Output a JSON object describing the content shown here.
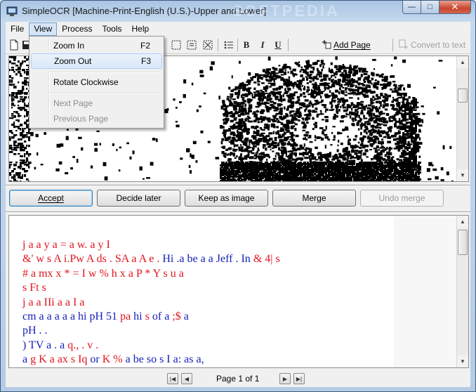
{
  "window": {
    "title": "SimpleOCR [Machine-Print-English (U.S.)-Upper and Lower]",
    "watermark": "SOFTPEDIA",
    "caption": {
      "minimize": "—",
      "maximize": "□",
      "close": "✕"
    }
  },
  "menubar": {
    "items": [
      {
        "label": "File"
      },
      {
        "label": "View"
      },
      {
        "label": "Process"
      },
      {
        "label": "Tools"
      },
      {
        "label": "Help"
      }
    ]
  },
  "view_menu": {
    "items": [
      {
        "label": "Zoom In",
        "accel": "F2",
        "state": "normal"
      },
      {
        "label": "Zoom Out",
        "accel": "F3",
        "state": "hover"
      },
      {
        "label": "Rotate Clockwise",
        "accel": "",
        "state": "normal"
      },
      {
        "label": "Next Page",
        "accel": "",
        "state": "disabled"
      },
      {
        "label": "Previous Page",
        "accel": "",
        "state": "disabled"
      }
    ]
  },
  "toolbar": {
    "bold": "B",
    "italic": "I",
    "underline": "U",
    "add_page": "Add Page",
    "convert_to_text": "Convert to text"
  },
  "actions": {
    "accept": "Accept",
    "decide_later": "Decide later",
    "keep_as_image": "Keep as image",
    "merge": "Merge",
    "undo_merge": "Undo merge"
  },
  "ocr_text": {
    "lines": [
      [
        {
          "t": "j a a y a = a w. a y I",
          "c": "red"
        }
      ],
      [
        {
          "t": "&' w s A i.Pw A ds . SA a A e . ",
          "c": "red"
        },
        {
          "t": "Hi .a be a a Jeff . In ",
          "c": "blue"
        },
        {
          "t": "& 4| s",
          "c": "red"
        }
      ],
      [
        {
          "t": "# a mx x * = I w % h x a P * Y s u a",
          "c": "red"
        }
      ],
      [
        {
          "t": "s Ft s",
          "c": "red"
        }
      ],
      [
        {
          "t": "j a a IIi a a I a",
          "c": "red"
        }
      ],
      [
        {
          "t": "cm a a a a a hi pH 51 ",
          "c": "blue"
        },
        {
          "t": "pa",
          "c": "red"
        },
        {
          "t": " hi ",
          "c": "blue"
        },
        {
          "t": "s",
          "c": "red"
        },
        {
          "t": " of a ",
          "c": "blue"
        },
        {
          "t": ";$",
          "c": "red"
        },
        {
          "t": " a",
          "c": "blue"
        }
      ],
      [
        {
          "t": "pH . .",
          "c": "blue"
        }
      ],
      [
        {
          "t": ") TV a . a ",
          "c": "blue"
        },
        {
          "t": "q., . v .",
          "c": "red"
        }
      ],
      [
        {
          "t": "a ",
          "c": "blue"
        },
        {
          "t": "g K a ax s Iq",
          "c": "red"
        },
        {
          "t": " or ",
          "c": "blue"
        },
        {
          "t": "K %",
          "c": "red"
        },
        {
          "t": " a be so s I a: as a,",
          "c": "blue"
        }
      ]
    ]
  },
  "pager": {
    "label": "Page 1 of 1"
  },
  "colors": {
    "ocr_red": "#e0141e",
    "ocr_blue": "#1520b8"
  }
}
